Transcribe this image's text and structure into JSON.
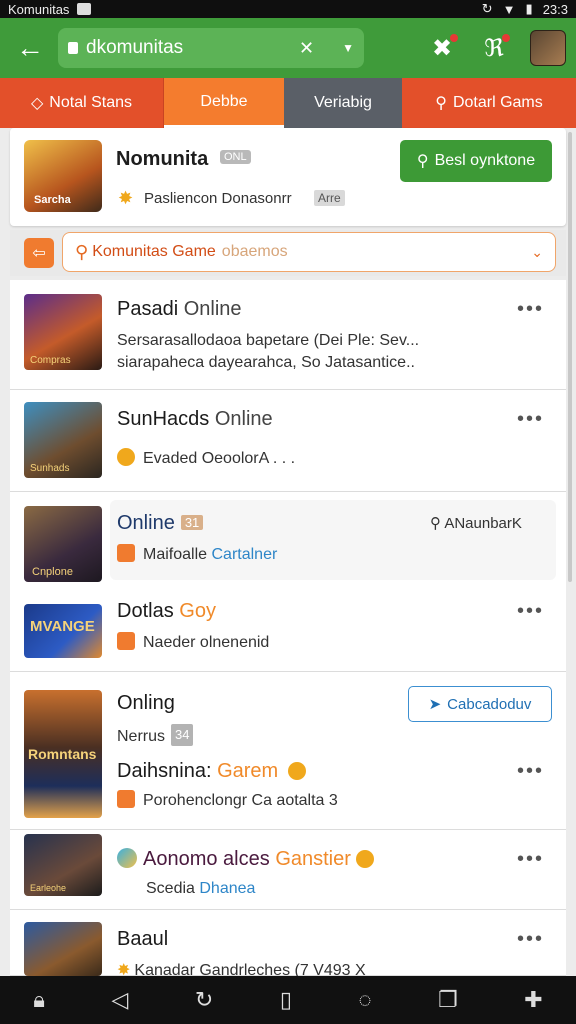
{
  "status_bar": {
    "title": "Komunitas",
    "time": "23:3"
  },
  "app_bar": {
    "search_value": "dkomunitas",
    "clear_glyph": "✕",
    "dropdown_glyph": "▼"
  },
  "tabs": [
    {
      "label": "Notal Stans",
      "icon": "tag-icon"
    },
    {
      "label": "Debbe"
    },
    {
      "label": "Veriabig"
    },
    {
      "label": "Dotarl Gams",
      "icon": "search-icon"
    }
  ],
  "featured": {
    "thumb_label": "Sarcha",
    "title": "Nomunita",
    "badge": "ONL",
    "subtitle": "Pasliencon Donasonrr",
    "chip": "Arre",
    "cta_label": "Besl oynktone"
  },
  "filter": {
    "label": "Komunitas Game",
    "hint": "obaemos"
  },
  "games": [
    {
      "thumb_label": "Compras",
      "title": "Pasadi",
      "status": "Online",
      "desc_line1": "Sersarasallodaoa bapetare (Dei Ple: Sev...",
      "desc_line2": "siarapaheca dayearahca, So Jatasantice.."
    },
    {
      "thumb_label": "Sunhads",
      "title": "SunHacds",
      "status": "Online",
      "desc": "Evaded OeoolorA . . ."
    },
    {
      "thumb_label": "Cnplone",
      "title": "Online",
      "badge": "31",
      "action_label": "ANaunbarK",
      "desc_plain": "Maifoalle",
      "desc_blue": "Cartalner"
    },
    {
      "thumb_label": "MVANGE",
      "title": "Dotlas",
      "title_hl": "Goy",
      "desc": "Naeder olnenenid"
    },
    {
      "thumb_label": "Romntans",
      "title": "Onling",
      "sub_label": "Nerrus",
      "sub_badge": "34",
      "button_label": "Cabcadoduv",
      "title2": "Daihsnina:",
      "title2_hl": "Garem",
      "desc": "Porohenclongr Ca aotalta 3"
    },
    {
      "thumb_label": "Earleohe",
      "title": "Aonomo alces",
      "title_hl": "Ganstier",
      "desc_plain": "Scedia",
      "desc_blue": "Dhanea"
    },
    {
      "thumb_label": "",
      "title": "Baaul",
      "desc": "Kanadar Gandrleches (7 V493 X"
    }
  ],
  "bottom_nav": [
    "lock-icon",
    "back-icon",
    "refresh-icon",
    "tabs-icon",
    "chat-icon",
    "windows-icon",
    "add-icon"
  ],
  "colors": {
    "green": "#3f9b3a",
    "orange": "#e8542a",
    "accent_blue": "#2e86c8"
  }
}
